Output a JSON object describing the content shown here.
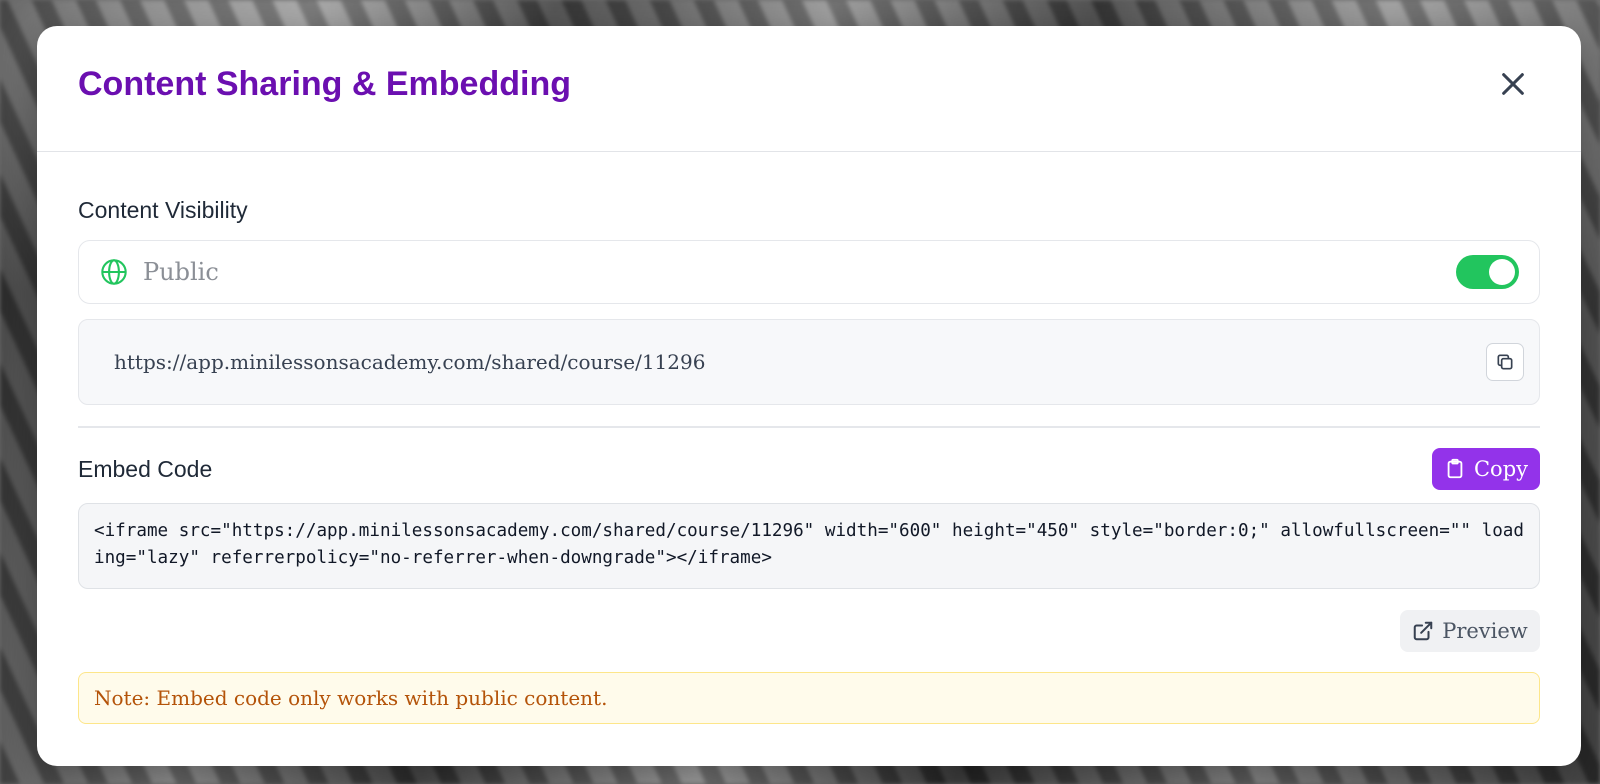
{
  "modal": {
    "title": "Content Sharing & Embedding"
  },
  "visibility": {
    "label": "Content Visibility",
    "status": "Public",
    "enabled": true,
    "toggle_color": "#22c55e"
  },
  "share": {
    "url": "https://app.minilessonsacademy.com/shared/course/11296"
  },
  "embed": {
    "label": "Embed Code",
    "copy_label": "Copy",
    "code": "<iframe src=\"https://app.minilessonsacademy.com/shared/course/11296\" width=\"600\" height=\"450\" style=\"border:0;\" allowfullscreen=\"\" loading=\"lazy\" referrerpolicy=\"no-referrer-when-downgrade\"></iframe>",
    "preview_label": "Preview"
  },
  "note": "Note: Embed code only works with public content.",
  "colors": {
    "title": "#6b0fb0",
    "accent": "#9333ea",
    "success": "#22c55e",
    "note_text": "#b45309"
  },
  "icons": {
    "close": "close-icon",
    "globe": "globe-icon",
    "copy_url": "copy-icon",
    "clipboard": "clipboard-icon",
    "external_link": "external-link-icon"
  }
}
